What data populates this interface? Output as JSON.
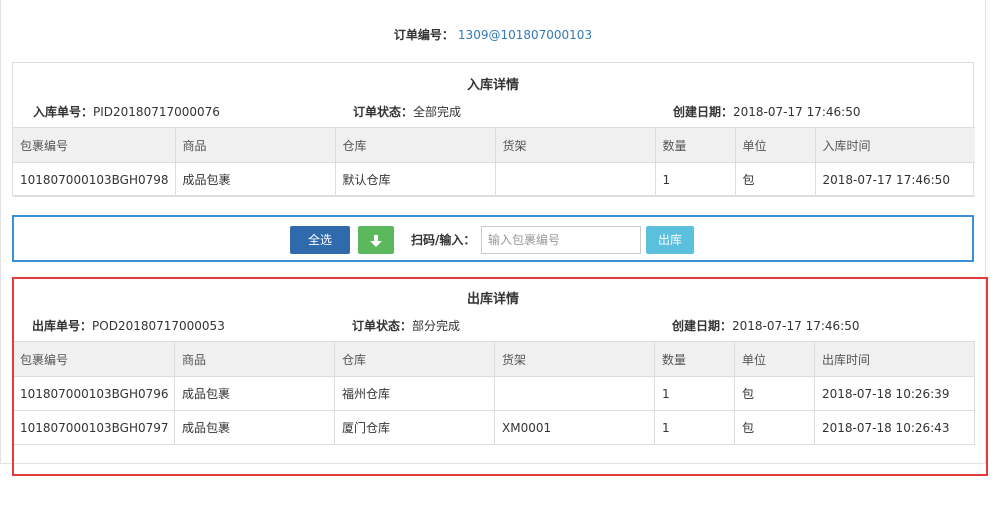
{
  "order": {
    "label": "订单编号：",
    "value": "1309@101807000103"
  },
  "inbound": {
    "title": "入库详情",
    "meta": [
      {
        "key": "入库单号：",
        "value": "PID20180717000076"
      },
      {
        "key": "订单状态：",
        "value": "全部完成"
      },
      {
        "key": "创建日期：",
        "value": "2018-07-17 17:46:50"
      }
    ],
    "columns": [
      "包裹编号",
      "商品",
      "仓库",
      "货架",
      "数量",
      "单位",
      "入库时间"
    ],
    "rows": [
      [
        "101807000103BGH0798",
        "成品包裹",
        "默认仓库",
        "",
        "1",
        "包",
        "2018-07-17 17:46:50"
      ]
    ]
  },
  "toolbar": {
    "select_all": "全选",
    "download_icon": "download-icon",
    "scan_label": "扫码/输入：",
    "placeholder": "输入包裹编号",
    "outbound_button": "出库"
  },
  "outbound": {
    "title": "出库详情",
    "meta": [
      {
        "key": "出库单号：",
        "value": "POD20180717000053"
      },
      {
        "key": "订单状态：",
        "value": "部分完成"
      },
      {
        "key": "创建日期：",
        "value": "2018-07-17 17:46:50"
      }
    ],
    "columns": [
      "包裹编号",
      "商品",
      "仓库",
      "货架",
      "数量",
      "单位",
      "出库时间"
    ],
    "rows": [
      [
        "101807000103BGH0796",
        "成品包裹",
        "福州仓库",
        "",
        "1",
        "包",
        "2018-07-18 10:26:39"
      ],
      [
        "101807000103BGH0797",
        "成品包裹",
        "厦门仓库",
        "XM0001",
        "1",
        "包",
        "2018-07-18 10:26:43"
      ]
    ]
  },
  "colors": {
    "primary": "#2f6aad",
    "success": "#5cb85c",
    "info": "#5bc0de",
    "link": "#337ab7",
    "toolbar_border": "#3a8fd6",
    "highlight_border": "#e23c3c"
  }
}
